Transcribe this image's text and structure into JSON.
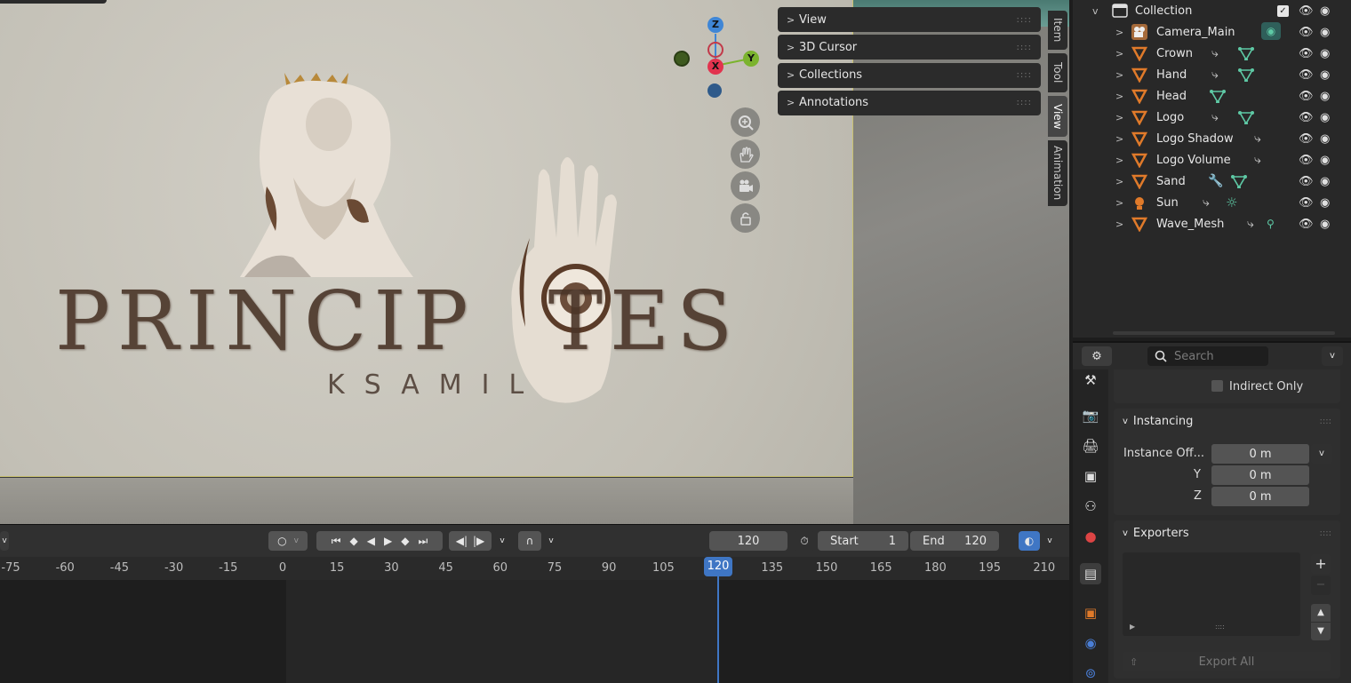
{
  "viewport": {
    "logo_title": "PRINCIP",
    "logo_title_end": "TES",
    "logo_sub": "KSAMIL",
    "gizmo": {
      "z": "Z",
      "x": "X",
      "y": "Y"
    },
    "npanel": [
      {
        "label": "View"
      },
      {
        "label": "3D Cursor"
      },
      {
        "label": "Collections"
      },
      {
        "label": "Annotations"
      }
    ],
    "sidebar_tabs": [
      "Item",
      "Tool",
      "View",
      "Animation"
    ],
    "active_tab": "View"
  },
  "timeline": {
    "current_frame": "120",
    "start_label": "Start",
    "start_value": "1",
    "end_label": "End",
    "end_value": "120",
    "ruler_ticks": [
      "-75",
      "-60",
      "-45",
      "-30",
      "-15",
      "0",
      "15",
      "30",
      "45",
      "60",
      "75",
      "90",
      "105",
      "120",
      "135",
      "150",
      "165",
      "180",
      "195",
      "210"
    ],
    "playhead": "120"
  },
  "outliner": {
    "root": "Collection",
    "items": [
      {
        "name": "Camera_Main",
        "type": "camera"
      },
      {
        "name": "Crown",
        "type": "mesh"
      },
      {
        "name": "Hand",
        "type": "mesh"
      },
      {
        "name": "Head",
        "type": "mesh"
      },
      {
        "name": "Logo",
        "type": "mesh"
      },
      {
        "name": "Logo Shadow",
        "type": "mesh"
      },
      {
        "name": "Logo Volume",
        "type": "mesh"
      },
      {
        "name": "Sand",
        "type": "mesh"
      },
      {
        "name": "Sun",
        "type": "light"
      },
      {
        "name": "Wave_Mesh",
        "type": "mesh"
      }
    ]
  },
  "properties": {
    "search_placeholder": "Search",
    "indirect_only": "Indirect Only",
    "instancing": {
      "title": "Instancing",
      "offset_label": "Instance Off...",
      "x": "0 m",
      "y_label": "Y",
      "y": "0 m",
      "z_label": "Z",
      "z": "0 m"
    },
    "exporters": {
      "title": "Exporters",
      "export_all": "Export All"
    }
  },
  "colors": {
    "accent": "#3f76c4",
    "mesh_orange": "#e07a2a",
    "modifier_green": "#5ec9a5"
  }
}
